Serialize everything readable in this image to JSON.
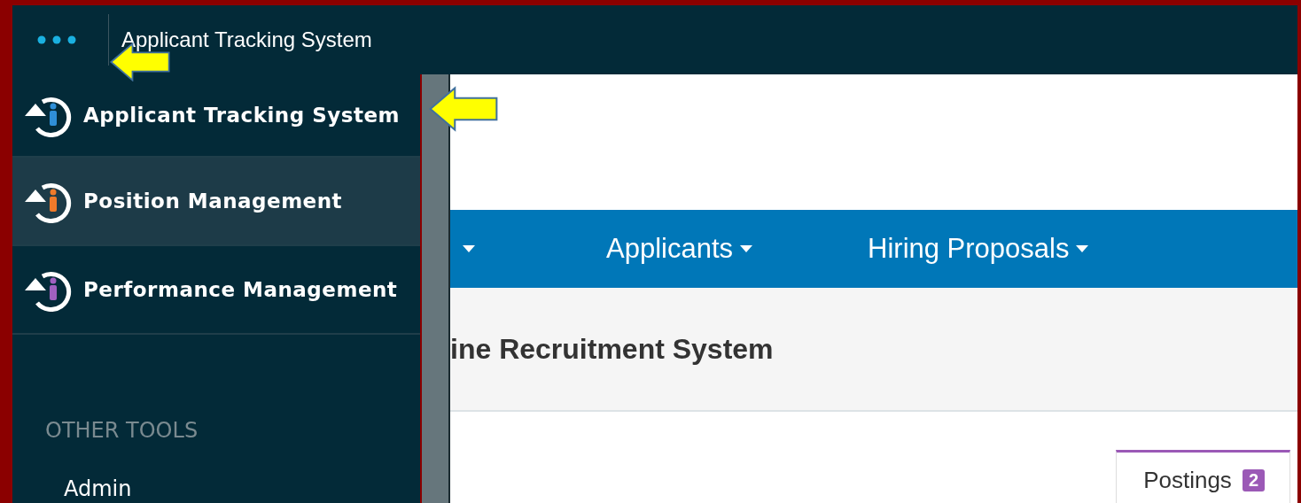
{
  "topbar": {
    "title": "Applicant Tracking System"
  },
  "sidebar": {
    "items": [
      {
        "label": "Applicant Tracking System",
        "color": "#2f8fd8",
        "selected": false
      },
      {
        "label": "Position Management",
        "color": "#f07a2a",
        "selected": true
      },
      {
        "label": "Performance Management",
        "color": "#a060c0",
        "selected": false
      }
    ],
    "section_title": "OTHER TOOLS",
    "links": [
      "Admin"
    ]
  },
  "nav": {
    "items": [
      {
        "kind": "caret"
      },
      {
        "kind": "menu",
        "label": "Applicants"
      },
      {
        "kind": "menu",
        "label": "Hiring Proposals"
      }
    ]
  },
  "page_header": {
    "title": "ine Recruitment System"
  },
  "tabs": [
    {
      "label": "Postings",
      "badge": "2",
      "selected": true
    }
  ]
}
